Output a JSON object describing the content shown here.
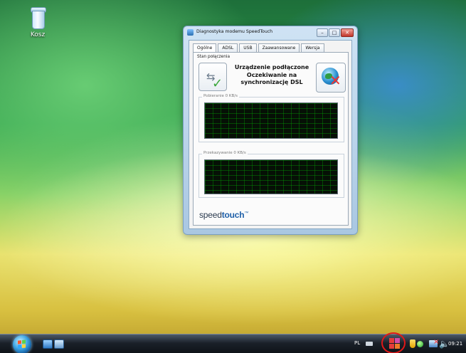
{
  "desktop": {
    "recycle_bin_label": "Kosz"
  },
  "window": {
    "title": "Diagnostyka modemu SpeedTouch",
    "controls": {
      "minimize": "–",
      "maximize": "□",
      "close": "✕"
    },
    "tabs": [
      {
        "label": "Ogólne",
        "active": true
      },
      {
        "label": "ADSL",
        "active": false
      },
      {
        "label": "USB",
        "active": false
      },
      {
        "label": "Zaawansowane",
        "active": false
      },
      {
        "label": "Wersja",
        "active": false
      }
    ],
    "status_caption": "Stan połączenia",
    "status_lines": [
      "Urządzenie podłączone",
      "Oczekiwanie na",
      "synchronizację DSL"
    ],
    "download_label": "Pobieranie 0 KB/s",
    "upload_label": "Przekazywanie 0 KB/s",
    "brand": {
      "part1": "speed",
      "part2": "touch",
      "mark": "™"
    },
    "icons": {
      "usb_connected": "usb-icon",
      "checkmark": "checkmark-icon",
      "network_disconnected": "globe-x-icon"
    }
  },
  "taskbar": {
    "start_button": "start-orb",
    "quick_launch": [
      "show-desktop-icon",
      "switch-windows-icon"
    ],
    "tray": {
      "language": "PL",
      "clock": "09:21",
      "icons": [
        "keyboard-icon",
        "modem-icon",
        "shield-icon",
        "green-status-icon",
        "network-icon",
        "volume-icon"
      ],
      "highlight_color": "#e01818"
    }
  }
}
